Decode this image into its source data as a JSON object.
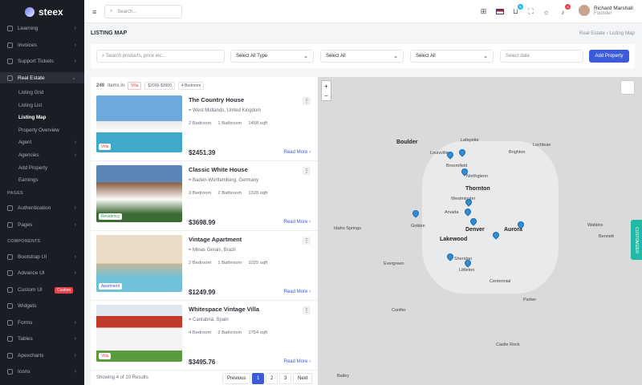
{
  "app": {
    "name": "steex"
  },
  "sidebar": {
    "items": [
      {
        "label": "Learning",
        "chev": "›"
      },
      {
        "label": "Invoices",
        "chev": "›"
      },
      {
        "label": "Support Tickets",
        "chev": "›"
      },
      {
        "label": "Real Estate",
        "chev": "⌄"
      }
    ],
    "sub": [
      {
        "label": "Listing Grid"
      },
      {
        "label": "Listing List"
      },
      {
        "label": "Listing Map"
      },
      {
        "label": "Property Overview"
      },
      {
        "label": "Agent"
      },
      {
        "label": "Agencies"
      },
      {
        "label": "Add Property"
      },
      {
        "label": "Earnings"
      }
    ],
    "sec_pages": "PAGES",
    "pages": [
      {
        "label": "Authentication"
      },
      {
        "label": "Pages"
      }
    ],
    "sec_components": "COMPONENTS",
    "components": [
      {
        "label": "Bootstrap UI"
      },
      {
        "label": "Advance UI"
      },
      {
        "label": "Custom UI",
        "badge": "Custom"
      },
      {
        "label": "Widgets"
      },
      {
        "label": "Forms"
      },
      {
        "label": "Tables"
      },
      {
        "label": "Apexcharts"
      },
      {
        "label": "Icons"
      }
    ]
  },
  "topbar": {
    "search_placeholder": "Search...",
    "badge_cart": "5",
    "badge_bell": "4",
    "user": {
      "name": "Richard Marshall",
      "role": "Founder"
    }
  },
  "page": {
    "title": "LISTING MAP",
    "crumb": "Real Estate  ›  Listing Map"
  },
  "filters": {
    "search_placeholder": "Search products, price etc...",
    "type": "Select All Type",
    "f2": "Select All",
    "f3": "Select All",
    "date_placeholder": "Select date",
    "add": "Add Property"
  },
  "list": {
    "count": "249",
    "items_in": "Items in",
    "chip1": "Villa",
    "chip2": "$2000-$3000",
    "chip3": "4 Bedroom"
  },
  "cards": [
    {
      "title": "The Country House",
      "loc": "West Midlands, United Kingdom",
      "bed": "2 Bedroom",
      "bath": "1 Bathroom",
      "area": "1458 sqft",
      "price": "$2451.39",
      "type": "Villa",
      "more": "Read More"
    },
    {
      "title": "Classic White House",
      "loc": "Baden-Württemberg, Germany",
      "bed": "3 Bedroom",
      "bath": "2 Bathroom",
      "area": "1328 sqft",
      "price": "$3698.99",
      "type": "Residency",
      "more": "Read More"
    },
    {
      "title": "Vintage Apartment",
      "loc": "Minas Gerais, Brazil",
      "bed": "2 Bedroom",
      "bath": "1 Bathroom",
      "area": "1025 sqft",
      "price": "$1249.99",
      "type": "Apartment",
      "more": "Read More"
    },
    {
      "title": "Whitespace Vintage Villa",
      "loc": "Cantabria, Spain",
      "bed": "4 Bedroom",
      "bath": "2 Bathroom",
      "area": "1754 sqft",
      "price": "$3495.76",
      "type": "Villa",
      "more": "Read More"
    }
  ],
  "pager": {
    "info": "Showing 4 of 10 Results",
    "prev": "Previous",
    "p1": "1",
    "p2": "2",
    "p3": "3",
    "next": "Next"
  },
  "map": {
    "labels": [
      "Boulder",
      "Louisville",
      "Broomfield",
      "Northglenn",
      "Thornton",
      "Lafayette",
      "Brighton",
      "Lochbuie",
      "Westminster",
      "Arvada",
      "Golden",
      "Denver",
      "Aurora",
      "Lakewood",
      "Evergreen",
      "Sheridan",
      "Littleton",
      "Centennial",
      "Parker",
      "Castle Rock",
      "Idaho Springs",
      "Bailey",
      "Conifer",
      "Watkins",
      "Bennett"
    ],
    "zoom_in": "+",
    "zoom_out": "−"
  },
  "customizer": "CUSTOMIZER"
}
